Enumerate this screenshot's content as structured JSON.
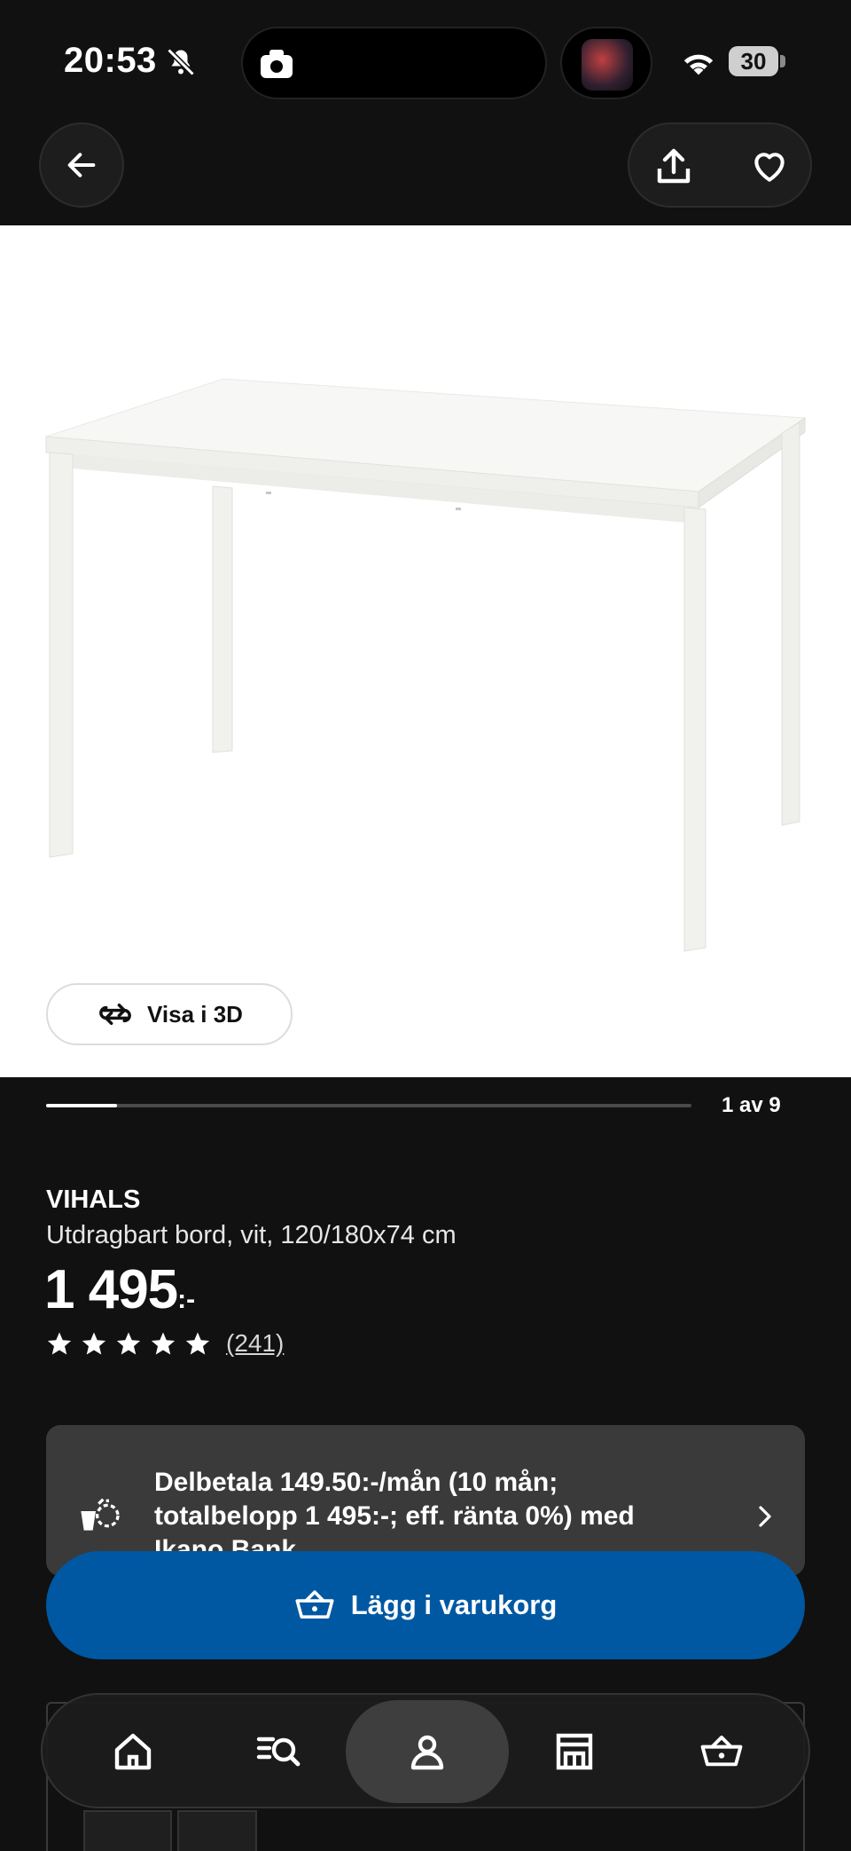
{
  "status_bar": {
    "time": "20:53",
    "battery": "30"
  },
  "nav": {
    "back_icon": "arrow-left-icon",
    "share_icon": "share-icon",
    "favorite_icon": "heart-icon"
  },
  "gallery": {
    "view_3d_label": "Visa i 3D",
    "counter": "1 av 9",
    "progress": 0.11
  },
  "product": {
    "brand": "VIHALS",
    "description": "Utdragbart bord, vit, 120/180x74 cm",
    "price": "1 495",
    "price_suffix": ":-",
    "rating_stars": 5,
    "review_count": "(241)"
  },
  "financing": {
    "text": "Delbetala 149.50:-/mån (10 mån; totalbelopp 1 495:-; eff. ränta 0%) med Ikano Bank"
  },
  "cart": {
    "add_label": "Lägg i varukorg"
  },
  "tabbar": {
    "items": [
      "home-icon",
      "search-list-icon",
      "profile-icon",
      "store-icon",
      "basket-icon"
    ],
    "active": "profile-icon"
  },
  "colors": {
    "background": "#111111",
    "accent_blue": "#0058a3",
    "card": "#3a3a3a"
  }
}
